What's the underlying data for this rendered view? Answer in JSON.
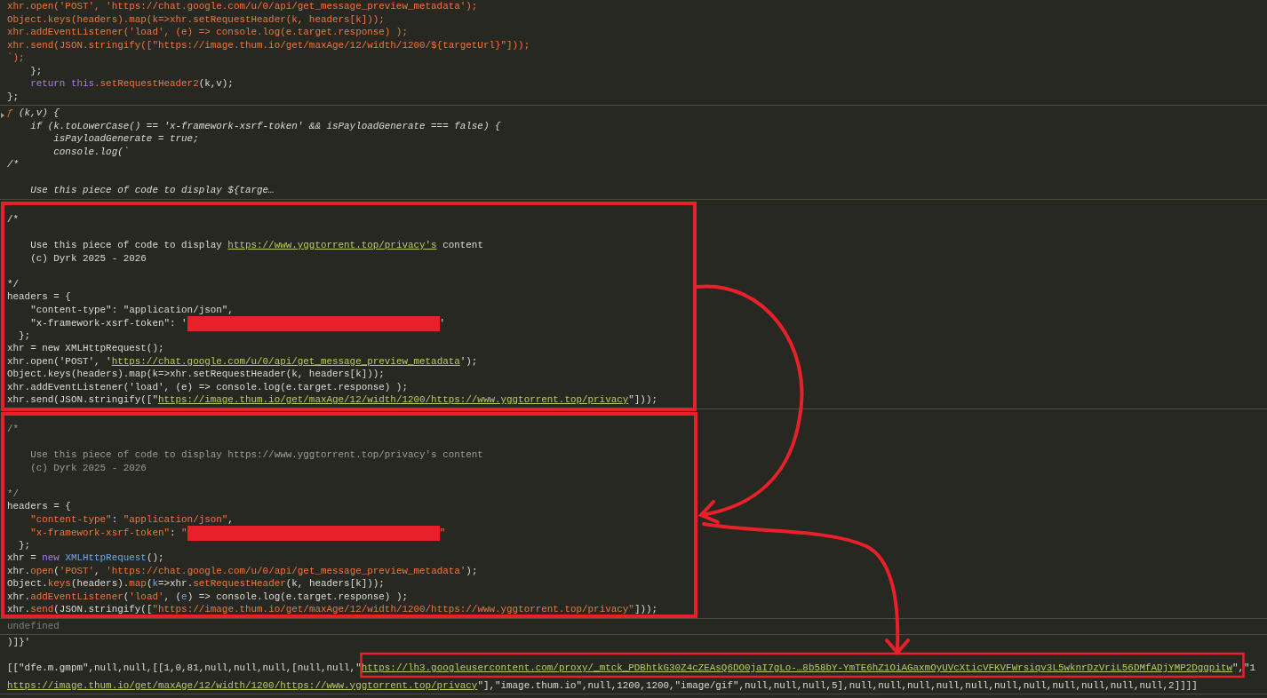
{
  "console": {
    "entries": [
      {
        "kind": "log",
        "lines": [
          {
            "segments": [
              {
                "kind": "str",
                "text": "xhr.open('POST', 'https://chat.google.com/u/0/api/get_message_preview_metadata');"
              }
            ]
          },
          {
            "segments": [
              {
                "kind": "str",
                "text": "Object.keys(headers).map(k=>xhr.setRequestHeader(k, headers[k]));"
              }
            ]
          },
          {
            "segments": [
              {
                "kind": "str",
                "text": "xhr.addEventListener('load', (e) => console.log(e.target.response) );"
              }
            ]
          },
          {
            "segments": [
              {
                "kind": "str",
                "text": "xhr.send(JSON.stringify([\"https://image.thum.io/get/maxAge/12/width/1200/${targetUrl}\"]));"
              }
            ]
          },
          {
            "segments": [
              {
                "kind": "str",
                "text": "`);"
              }
            ]
          },
          {
            "segments": [
              {
                "kind": "plain",
                "text": "    };"
              }
            ]
          },
          {
            "segments": [
              {
                "kind": "kw",
                "text": "    return this"
              },
              {
                "kind": "str",
                "text": ".setRequestHeader2"
              },
              {
                "kind": "plain",
                "text": "(k,v);"
              }
            ]
          },
          {
            "segments": [
              {
                "kind": "plain",
                "text": "};"
              }
            ]
          }
        ]
      },
      {
        "kind": "function",
        "expanded": false,
        "lines": [
          {
            "segments": [
              {
                "kind": "str",
                "text": "ƒ"
              },
              {
                "kind": "plain",
                "text": " (k,v) {"
              }
            ]
          },
          {
            "segments": [
              {
                "kind": "plain",
                "text": "    if (k.toLowerCase() == 'x-framework-xsrf-token' && isPayloadGenerate === false) {"
              }
            ]
          },
          {
            "segments": [
              {
                "kind": "plain",
                "text": "        isPayloadGenerate = true;"
              }
            ]
          },
          {
            "segments": [
              {
                "kind": "plain",
                "text": "        console.log(`"
              }
            ]
          },
          {
            "segments": [
              {
                "kind": "plain",
                "text": "/*"
              }
            ]
          },
          {
            "kind": "blank"
          },
          {
            "segments": [
              {
                "kind": "plain",
                "text": "    Use this piece of code to display ${targe…"
              }
            ]
          }
        ]
      },
      {
        "kind": "log",
        "lines": [
          {
            "kind": "blank"
          },
          {
            "segments": [
              {
                "kind": "plain",
                "text": "/*"
              }
            ]
          },
          {
            "kind": "blank"
          },
          {
            "segments": [
              {
                "kind": "plain",
                "text": "    Use this piece of code to display "
              },
              {
                "kind": "link",
                "text": "https://www.yggtorrent.top/privacy's"
              },
              {
                "kind": "plain",
                "text": " content"
              }
            ]
          },
          {
            "segments": [
              {
                "kind": "plain",
                "text": "    (c) Dyrk 2025 - 2026"
              }
            ]
          },
          {
            "kind": "blank"
          },
          {
            "segments": [
              {
                "kind": "plain",
                "text": "*/"
              }
            ]
          },
          {
            "segments": [
              {
                "kind": "plain",
                "text": "headers = {"
              }
            ]
          },
          {
            "segments": [
              {
                "kind": "plain",
                "text": "    \"content-type\": \"application/json\","
              }
            ]
          },
          {
            "segments": [
              {
                "kind": "plain",
                "text": "    \"x-framework-xsrf-token\": '"
              },
              {
                "kind": "redaction"
              },
              {
                "kind": "plain",
                "text": "'"
              }
            ]
          },
          {
            "segments": [
              {
                "kind": "plain",
                "text": "  };"
              }
            ]
          },
          {
            "segments": [
              {
                "kind": "plain",
                "text": "xhr = new XMLHttpRequest();"
              }
            ]
          },
          {
            "segments": [
              {
                "kind": "plain",
                "text": "xhr.open('POST', '"
              },
              {
                "kind": "link",
                "text": "https://chat.google.com/u/0/api/get_message_preview_metadata"
              },
              {
                "kind": "plain",
                "text": "');"
              }
            ]
          },
          {
            "segments": [
              {
                "kind": "plain",
                "text": "Object.keys(headers).map(k=>xhr.setRequestHeader(k, headers[k]));"
              }
            ]
          },
          {
            "segments": [
              {
                "kind": "plain",
                "text": "xhr.addEventListener('load', (e) => console.log(e.target.response) );"
              }
            ]
          },
          {
            "segments": [
              {
                "kind": "plain",
                "text": "xhr.send(JSON.stringify([\""
              },
              {
                "kind": "link",
                "text": "https://image.thum.io/get/maxAge/12/width/1200/https://www.yggtorrent.top/privacy"
              },
              {
                "kind": "plain",
                "text": "\"]));"
              }
            ]
          }
        ]
      },
      {
        "kind": "log",
        "lines": [
          {
            "kind": "blank"
          },
          {
            "segments": [
              {
                "kind": "comment",
                "text": "/*"
              }
            ]
          },
          {
            "kind": "blank"
          },
          {
            "segments": [
              {
                "kind": "comment",
                "text": "    Use this piece of code to display https://www.yggtorrent.top/privacy's content"
              }
            ]
          },
          {
            "segments": [
              {
                "kind": "comment",
                "text": "    (c) Dyrk 2025 - 2026"
              }
            ]
          },
          {
            "kind": "blank"
          },
          {
            "segments": [
              {
                "kind": "comment",
                "text": "*/"
              }
            ]
          },
          {
            "segments": [
              {
                "kind": "plain",
                "text": "headers = {"
              }
            ]
          },
          {
            "segments": [
              {
                "kind": "str",
                "text": "    \"content-type\""
              },
              {
                "kind": "plain",
                "text": ": "
              },
              {
                "kind": "str",
                "text": "\"application/json\""
              },
              {
                "kind": "plain",
                "text": ","
              }
            ]
          },
          {
            "segments": [
              {
                "kind": "str",
                "text": "    \"x-framework-xsrf-token\""
              },
              {
                "kind": "plain",
                "text": ": "
              },
              {
                "kind": "str",
                "text": "\""
              },
              {
                "kind": "redaction"
              },
              {
                "kind": "str",
                "text": "\""
              }
            ]
          },
          {
            "segments": [
              {
                "kind": "plain",
                "text": "  };"
              }
            ]
          },
          {
            "segments": [
              {
                "kind": "plain",
                "text": "xhr = "
              },
              {
                "kind": "kw",
                "text": "new "
              },
              {
                "kind": "type",
                "text": "XMLHttpRequest"
              },
              {
                "kind": "plain",
                "text": "();"
              }
            ]
          },
          {
            "segments": [
              {
                "kind": "plain",
                "text": "xhr."
              },
              {
                "kind": "str",
                "text": "open"
              },
              {
                "kind": "plain",
                "text": "("
              },
              {
                "kind": "str",
                "text": "'POST'"
              },
              {
                "kind": "plain",
                "text": ", "
              },
              {
                "kind": "str",
                "text": "'https://chat.google.com/u/0/api/get_message_preview_metadata'"
              },
              {
                "kind": "plain",
                "text": ");"
              }
            ]
          },
          {
            "segments": [
              {
                "kind": "plain",
                "text": "Object."
              },
              {
                "kind": "str",
                "text": "keys"
              },
              {
                "kind": "plain",
                "text": "(headers)."
              },
              {
                "kind": "str",
                "text": "map"
              },
              {
                "kind": "plain",
                "text": "("
              },
              {
                "kind": "type",
                "text": "k"
              },
              {
                "kind": "plain",
                "text": "=>xhr."
              },
              {
                "kind": "str",
                "text": "setRequestHeader"
              },
              {
                "kind": "plain",
                "text": "(k, headers[k]));"
              }
            ]
          },
          {
            "segments": [
              {
                "kind": "plain",
                "text": "xhr."
              },
              {
                "kind": "str",
                "text": "addEventListener"
              },
              {
                "kind": "plain",
                "text": "("
              },
              {
                "kind": "str",
                "text": "'load'"
              },
              {
                "kind": "plain",
                "text": ", ("
              },
              {
                "kind": "type",
                "text": "e"
              },
              {
                "kind": "plain",
                "text": ") => console.log(e.target.response) );"
              }
            ]
          },
          {
            "segments": [
              {
                "kind": "plain",
                "text": "xhr."
              },
              {
                "kind": "str",
                "text": "send"
              },
              {
                "kind": "plain",
                "text": "(JSON.stringify(["
              },
              {
                "kind": "str",
                "text": "\"https://image.thum.io/get/maxAge/12/width/1200/https://www.yggtorrent.top/privacy\""
              },
              {
                "kind": "plain",
                "text": "]));"
              }
            ]
          }
        ]
      },
      {
        "kind": "result",
        "lines": [
          {
            "segments": [
              {
                "kind": "plain",
                "text": "undefined"
              }
            ]
          }
        ]
      },
      {
        "kind": "log",
        "lines": [
          {
            "segments": [
              {
                "kind": "plain",
                "text": ")]}'"
              }
            ]
          },
          {
            "kind": "blank"
          },
          {
            "segments": [
              {
                "kind": "plain",
                "text": "[[\"dfe.m.gmpm\",null,null,[[1,0,81,null,null,null,[null,null,\""
              },
              {
                "kind": "link",
                "text": "https://lh3.googleusercontent.com/proxy/_mtck_PDBhtkG30Z4cZEAsQ6DO0jaI7gLo-…8b58bY-YmTE6hZ1OiAGaxmOyUVcXticVFKVFWrsiqv3L5wknrDzVriL56DMfADjYMP2Dggpitw"
              },
              {
                "kind": "plain",
                "text": "\",\"1"
              }
            ]
          },
          {
            "segments": [
              {
                "kind": "link",
                "text": "https://image.thum.io/get/maxAge/12/width/1200/https://www.yggtorrent.top/privacy"
              },
              {
                "kind": "plain",
                "text": "\"],\"image.thum.io\",null,1200,1200,\"image/gif\",null,null,null,5],null,null,null,null,null,null,null,null,null,null,null,2]]]]"
              }
            ]
          }
        ]
      }
    ]
  }
}
